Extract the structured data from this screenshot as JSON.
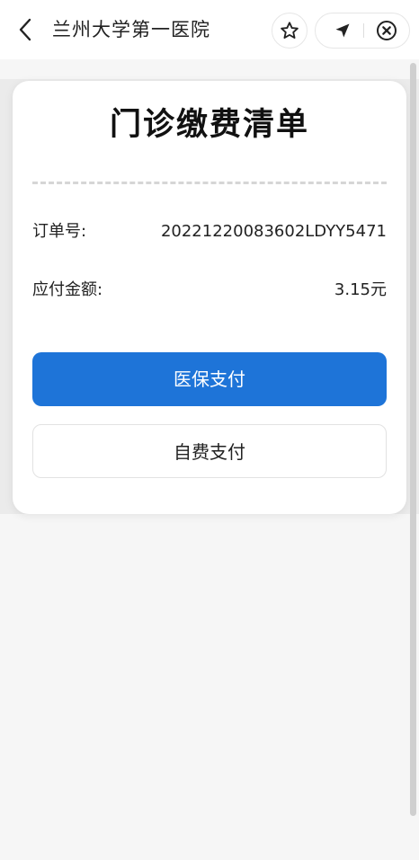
{
  "navbar": {
    "title": "兰州大学第一医院",
    "icons": {
      "back": "chevron-left-icon",
      "favorite": "star-icon",
      "share": "send-arrow-icon",
      "close": "close-circle-icon"
    }
  },
  "bill": {
    "title": "门诊缴费清单",
    "order_label": "订单号:",
    "order_value": "20221220083602LDYY5471",
    "amount_label": "应付金额:",
    "amount_value": "3.15元"
  },
  "actions": {
    "insurance_pay": "医保支付",
    "self_pay": "自费支付"
  },
  "colors": {
    "primary_button": "#1e74d8",
    "card_background": "#ffffff",
    "page_background": "#f6f6f6"
  }
}
